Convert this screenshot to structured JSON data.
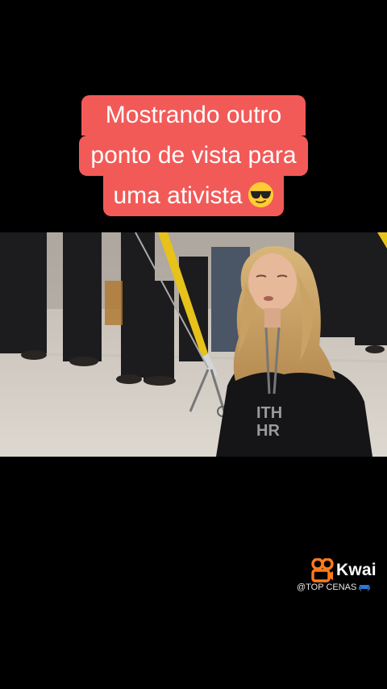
{
  "caption": {
    "line1": "Mostrando outro",
    "line2": "ponto de vista para",
    "line3": "uma ativista",
    "emoji": "sunglasses-face-emoji"
  },
  "video": {
    "shirt_text_line1": "ITH",
    "shirt_text_line2": "HR"
  },
  "watermark": {
    "brand": "Kwai",
    "handle": "@TOP CENAS",
    "handle_icon": "couch-icon",
    "logo_icon": "kwai-logo-icon",
    "brand_color": "#ff7a1a"
  }
}
